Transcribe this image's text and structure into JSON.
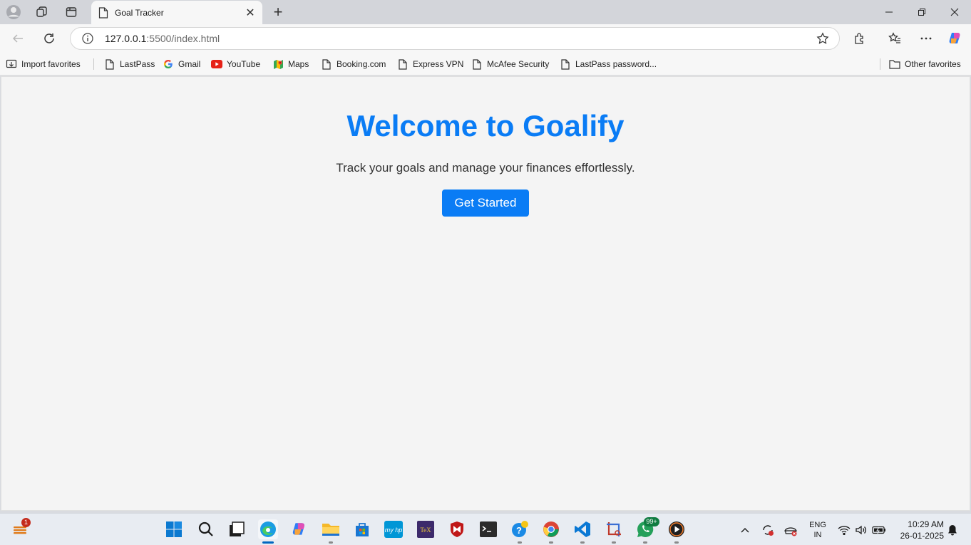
{
  "browser": {
    "tab": {
      "title": "Goal Tracker"
    },
    "address": {
      "host": "127.0.0.1",
      "rest": ":5500/index.html"
    },
    "favorites": [
      {
        "label": "Import favorites",
        "icon": "import-icon"
      },
      {
        "label": "LastPass",
        "icon": "page-icon"
      },
      {
        "label": "Gmail",
        "icon": "google-icon"
      },
      {
        "label": "YouTube",
        "icon": "youtube-icon"
      },
      {
        "label": "Maps",
        "icon": "maps-icon"
      },
      {
        "label": "Booking.com",
        "icon": "page-icon"
      },
      {
        "label": "Express VPN",
        "icon": "page-icon"
      },
      {
        "label": "McAfee Security",
        "icon": "page-icon"
      },
      {
        "label": "LastPass password...",
        "icon": "page-icon"
      }
    ],
    "other_favorites": "Other favorites"
  },
  "page": {
    "title": "Welcome to Goalify",
    "subtitle": "Track your goals and manage your finances effortlessly.",
    "cta": "Get Started"
  },
  "taskbar": {
    "weather_badge": "1",
    "whatsapp_badge": "99+",
    "lang_line1": "ENG",
    "lang_line2": "IN",
    "time": "10:29 AM",
    "date": "26-01-2025"
  },
  "colors": {
    "accent": "#0a7cf5",
    "page_bg": "#f4f4f4",
    "taskbar_bg": "#e8ecf2"
  }
}
